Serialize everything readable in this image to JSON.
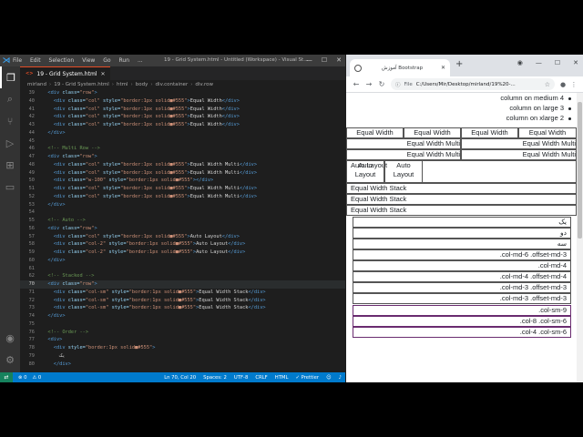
{
  "vscode": {
    "menu": [
      "File",
      "Edit",
      "Selection",
      "View",
      "Go",
      "Run",
      "..."
    ],
    "window_title": "19 - Grid System.html - Untitled (Workspace) - Visual St...",
    "tab": {
      "label": "19 - Grid System.html",
      "icon": "html-file-icon"
    },
    "breadcrumb": [
      "mirland",
      "19 - Grid System.html",
      "html",
      "body",
      "div.container",
      "div.row"
    ],
    "lines": [
      {
        "n": "39",
        "c": [
          [
            "i",
            "  "
          ],
          [
            "tag",
            "<div "
          ],
          [
            "attr",
            "class="
          ],
          [
            "str",
            "\"row\""
          ],
          [
            "tag",
            ">"
          ]
        ]
      },
      {
        "n": "40",
        "c": [
          [
            "i",
            "    "
          ],
          [
            "tag",
            "<div "
          ],
          [
            "attr",
            "class="
          ],
          [
            "str",
            "\"col\" "
          ],
          [
            "attr",
            "style="
          ],
          [
            "str",
            "\"border:1px solid■#555\""
          ],
          [
            "tag",
            ">"
          ],
          [
            "txt",
            "Equal Width"
          ],
          [
            "tag",
            "</div>"
          ]
        ]
      },
      {
        "n": "41",
        "c": [
          [
            "i",
            "    "
          ],
          [
            "tag",
            "<div "
          ],
          [
            "attr",
            "class="
          ],
          [
            "str",
            "\"col\" "
          ],
          [
            "attr",
            "style="
          ],
          [
            "str",
            "\"border:1px solid■#555\""
          ],
          [
            "tag",
            ">"
          ],
          [
            "txt",
            "Equal Width"
          ],
          [
            "tag",
            "</div>"
          ]
        ]
      },
      {
        "n": "42",
        "c": [
          [
            "i",
            "    "
          ],
          [
            "tag",
            "<div "
          ],
          [
            "attr",
            "class="
          ],
          [
            "str",
            "\"col\" "
          ],
          [
            "attr",
            "style="
          ],
          [
            "str",
            "\"border:1px solid■#555\""
          ],
          [
            "tag",
            ">"
          ],
          [
            "txt",
            "Equal Width"
          ],
          [
            "tag",
            "</div>"
          ]
        ]
      },
      {
        "n": "43",
        "c": [
          [
            "i",
            "    "
          ],
          [
            "tag",
            "<div "
          ],
          [
            "attr",
            "class="
          ],
          [
            "str",
            "\"col\" "
          ],
          [
            "attr",
            "style="
          ],
          [
            "str",
            "\"border:1px solid■#555\""
          ],
          [
            "tag",
            ">"
          ],
          [
            "txt",
            "Equal Width"
          ],
          [
            "tag",
            "</div>"
          ]
        ]
      },
      {
        "n": "44",
        "c": [
          [
            "i",
            "  "
          ],
          [
            "tag",
            "</div>"
          ]
        ]
      },
      {
        "n": "45",
        "c": []
      },
      {
        "n": "46",
        "c": [
          [
            "i",
            "  "
          ],
          [
            "com",
            "<!-- Multi Row -->"
          ]
        ]
      },
      {
        "n": "47",
        "c": [
          [
            "i",
            "  "
          ],
          [
            "tag",
            "<div "
          ],
          [
            "attr",
            "class="
          ],
          [
            "str",
            "\"row\""
          ],
          [
            "tag",
            ">"
          ]
        ]
      },
      {
        "n": "48",
        "c": [
          [
            "i",
            "    "
          ],
          [
            "tag",
            "<div "
          ],
          [
            "attr",
            "class="
          ],
          [
            "str",
            "\"col\" "
          ],
          [
            "attr",
            "style="
          ],
          [
            "str",
            "\"border:1px solid■#555\""
          ],
          [
            "tag",
            ">"
          ],
          [
            "txt",
            "Equal Width Multi"
          ],
          [
            "tag",
            "</div>"
          ]
        ]
      },
      {
        "n": "49",
        "c": [
          [
            "i",
            "    "
          ],
          [
            "tag",
            "<div "
          ],
          [
            "attr",
            "class="
          ],
          [
            "str",
            "\"col\" "
          ],
          [
            "attr",
            "style="
          ],
          [
            "str",
            "\"border:1px solid■#555\""
          ],
          [
            "tag",
            ">"
          ],
          [
            "txt",
            "Equal Width Multi"
          ],
          [
            "tag",
            "</div>"
          ]
        ]
      },
      {
        "n": "50",
        "c": [
          [
            "i",
            "    "
          ],
          [
            "tag",
            "<div "
          ],
          [
            "attr",
            "class="
          ],
          [
            "str",
            "\"w-100\" "
          ],
          [
            "attr",
            "style="
          ],
          [
            "str",
            "\"border:1px solid■#555\""
          ],
          [
            "tag",
            ">"
          ],
          [
            "tag",
            "</div>"
          ]
        ]
      },
      {
        "n": "51",
        "c": [
          [
            "i",
            "    "
          ],
          [
            "tag",
            "<div "
          ],
          [
            "attr",
            "class="
          ],
          [
            "str",
            "\"col\" "
          ],
          [
            "attr",
            "style="
          ],
          [
            "str",
            "\"border:1px solid■#555\""
          ],
          [
            "tag",
            ">"
          ],
          [
            "txt",
            "Equal Width Multi"
          ],
          [
            "tag",
            "</div>"
          ]
        ]
      },
      {
        "n": "52",
        "c": [
          [
            "i",
            "    "
          ],
          [
            "tag",
            "<div "
          ],
          [
            "attr",
            "class="
          ],
          [
            "str",
            "\"col\" "
          ],
          [
            "attr",
            "style="
          ],
          [
            "str",
            "\"border:1px solid■#555\""
          ],
          [
            "tag",
            ">"
          ],
          [
            "txt",
            "Equal Width Multi"
          ],
          [
            "tag",
            "</div>"
          ]
        ]
      },
      {
        "n": "53",
        "c": [
          [
            "i",
            "  "
          ],
          [
            "tag",
            "</div>"
          ]
        ]
      },
      {
        "n": "54",
        "c": []
      },
      {
        "n": "55",
        "c": [
          [
            "i",
            "  "
          ],
          [
            "com",
            "<!-- Auto -->"
          ]
        ]
      },
      {
        "n": "56",
        "c": [
          [
            "i",
            "  "
          ],
          [
            "tag",
            "<div "
          ],
          [
            "attr",
            "class="
          ],
          [
            "str",
            "\"row\""
          ],
          [
            "tag",
            ">"
          ]
        ]
      },
      {
        "n": "57",
        "c": [
          [
            "i",
            "    "
          ],
          [
            "tag",
            "<div "
          ],
          [
            "attr",
            "class="
          ],
          [
            "str",
            "\"col\" "
          ],
          [
            "attr",
            "style="
          ],
          [
            "str",
            "\"border:1px solid■#555\""
          ],
          [
            "tag",
            ">"
          ],
          [
            "txt",
            "Auto Layout"
          ],
          [
            "tag",
            "</div>"
          ]
        ]
      },
      {
        "n": "58",
        "c": [
          [
            "i",
            "    "
          ],
          [
            "tag",
            "<div "
          ],
          [
            "attr",
            "class="
          ],
          [
            "str",
            "\"col-2\" "
          ],
          [
            "attr",
            "style="
          ],
          [
            "str",
            "\"border:1px solid■#555\""
          ],
          [
            "tag",
            ">"
          ],
          [
            "txt",
            "Auto Layout"
          ],
          [
            "tag",
            "</div>"
          ]
        ]
      },
      {
        "n": "59",
        "c": [
          [
            "i",
            "    "
          ],
          [
            "tag",
            "<div "
          ],
          [
            "attr",
            "class="
          ],
          [
            "str",
            "\"col-2\" "
          ],
          [
            "attr",
            "style="
          ],
          [
            "str",
            "\"border:1px solid■#555\""
          ],
          [
            "tag",
            ">"
          ],
          [
            "txt",
            "Auto Layout"
          ],
          [
            "tag",
            "</div>"
          ]
        ]
      },
      {
        "n": "60",
        "c": [
          [
            "i",
            "  "
          ],
          [
            "tag",
            "</div>"
          ]
        ]
      },
      {
        "n": "61",
        "c": []
      },
      {
        "n": "62",
        "c": [
          [
            "i",
            "  "
          ],
          [
            "com",
            "<!-- Stacked -->"
          ]
        ]
      },
      {
        "n": "70",
        "c": [
          [
            "i",
            "  "
          ],
          [
            "tag",
            "<div "
          ],
          [
            "attr",
            "class="
          ],
          [
            "str",
            "\"row\""
          ],
          [
            "tag",
            ">"
          ]
        ],
        "current": true
      },
      {
        "n": "71",
        "c": [
          [
            "i",
            "    "
          ],
          [
            "tag",
            "<div "
          ],
          [
            "attr",
            "class="
          ],
          [
            "str",
            "\"col-sm\" "
          ],
          [
            "attr",
            "style="
          ],
          [
            "str",
            "\"border:1px solid■#555\""
          ],
          [
            "tag",
            ">"
          ],
          [
            "txt",
            "Equal Width Stack"
          ],
          [
            "tag",
            "</div>"
          ]
        ]
      },
      {
        "n": "72",
        "c": [
          [
            "i",
            "    "
          ],
          [
            "tag",
            "<div "
          ],
          [
            "attr",
            "class="
          ],
          [
            "str",
            "\"col-sm\" "
          ],
          [
            "attr",
            "style="
          ],
          [
            "str",
            "\"border:1px solid■#555\""
          ],
          [
            "tag",
            ">"
          ],
          [
            "txt",
            "Equal Width Stack"
          ],
          [
            "tag",
            "</div>"
          ]
        ]
      },
      {
        "n": "73",
        "c": [
          [
            "i",
            "    "
          ],
          [
            "tag",
            "<div "
          ],
          [
            "attr",
            "class="
          ],
          [
            "str",
            "\"col-sm\" "
          ],
          [
            "attr",
            "style="
          ],
          [
            "str",
            "\"border:1px solid■#555\""
          ],
          [
            "tag",
            ">"
          ],
          [
            "txt",
            "Equal Width Stack"
          ],
          [
            "tag",
            "</div>"
          ]
        ]
      },
      {
        "n": "74",
        "c": [
          [
            "i",
            "  "
          ],
          [
            "tag",
            "</div>"
          ]
        ]
      },
      {
        "n": "75",
        "c": []
      },
      {
        "n": "76",
        "c": [
          [
            "i",
            "  "
          ],
          [
            "com",
            "<!-- Order -->"
          ]
        ]
      },
      {
        "n": "77",
        "c": [
          [
            "i",
            "  "
          ],
          [
            "tag",
            "<div>"
          ]
        ]
      },
      {
        "n": "78",
        "c": [
          [
            "i",
            "    "
          ],
          [
            "tag",
            "<div "
          ],
          [
            "attr",
            "style="
          ],
          [
            "str",
            "\"border:1px solid■#555\""
          ],
          [
            "tag",
            ">"
          ]
        ]
      },
      {
        "n": "79",
        "c": [
          [
            "i",
            "      "
          ],
          [
            "txt",
            "یک"
          ]
        ]
      },
      {
        "n": "80",
        "c": [
          [
            "i",
            "    "
          ],
          [
            "tag",
            "</div>"
          ]
        ]
      }
    ],
    "status": {
      "errors": "⊗ 0",
      "warnings": "⚠ 0",
      "position": "Ln 70, Col 20",
      "spaces": "Spaces: 2",
      "encoding": "UTF-8",
      "eol": "CRLF",
      "language": "HTML",
      "prettier": "✓ Prettier"
    }
  },
  "chrome": {
    "tab_title": "آموزش Bootstrap",
    "url_scheme": "File",
    "url": "C:/Users/Mir/Desktop/mirland/19%20-...",
    "list_items": [
      "column on medium 4",
      "column on large 3",
      "column on xlarge 2"
    ],
    "row_equal": [
      "Equal Width",
      "Equal Width",
      "Equal Width",
      "Equal Width"
    ],
    "row_multi": [
      "Equal Width Multi",
      "Equal Width Multi",
      "Equal Width Multi",
      "Equal Width Multi"
    ],
    "row_auto": [
      "Auto Layout",
      "Auto Layout",
      "Auto Layout"
    ],
    "row_stack": [
      "Equal Width Stack",
      "Equal Width Stack",
      "Equal Width Stack"
    ],
    "order_items": [
      "یک",
      "دو",
      "سه"
    ],
    "offset_items": [
      "col-md-6 .offset-md-3.",
      "col-md-4.",
      "col-md-4 .offset-md-4.",
      "col-md-3 .offset-md-3.",
      "col-md-3 .offset-md-3."
    ],
    "nested_items": [
      "col-sm-9.",
      "col-8 .col-sm-6.",
      "col-4 .col-sm-6."
    ]
  }
}
